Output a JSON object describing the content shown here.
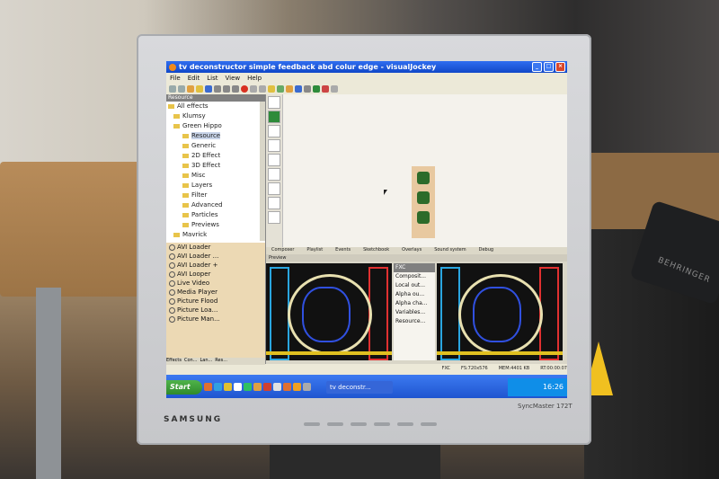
{
  "window": {
    "title": "tv deconstructor simple feedback abd colur edge - visualJockey"
  },
  "menu": [
    "File",
    "Edit",
    "List",
    "View",
    "Help"
  ],
  "resource_panel": {
    "header": "Resource",
    "tree": [
      "All effects",
      "Klumsy",
      "Green Hippo",
      "Resource",
      "Generic",
      "2D Effect",
      "3D Effect",
      "Misc",
      "Layers",
      "Filter",
      "Advanced",
      "Particles",
      "Previews",
      "Mavrick"
    ],
    "selected": "Resource"
  },
  "effects_list": [
    "AVI Loader",
    "AVI Loader ...",
    "AVI Loader +",
    "AVI Looper",
    "Live Video",
    "Media Player",
    "Picture Flood",
    "Picture Loa...",
    "Picture Man..."
  ],
  "left_tabs": [
    "Effects",
    "Con...",
    "Lan...",
    "Res..."
  ],
  "composer_tabs": [
    "Composer",
    "Playlist",
    "Events",
    "Sketchbook",
    "Overlays",
    "Sound system",
    "Debug"
  ],
  "preview": {
    "header": "Preview"
  },
  "fx_panel": {
    "header": "FXC",
    "items": [
      "Composit...",
      "Local out...",
      "Alpha ou...",
      "Alpha cha...",
      "Variables...",
      "Resource..."
    ]
  },
  "status": [
    "FXC",
    "FS:720x576",
    "MEM:4401 KB",
    "RT:00:00:07"
  ],
  "taskbar": {
    "start": "Start",
    "task": "tv deconstr...",
    "clock": "16:26"
  },
  "monitor": {
    "brand": "SAMSUNG",
    "model": "SyncMaster 172T"
  },
  "device_label": "BEHRINGER"
}
